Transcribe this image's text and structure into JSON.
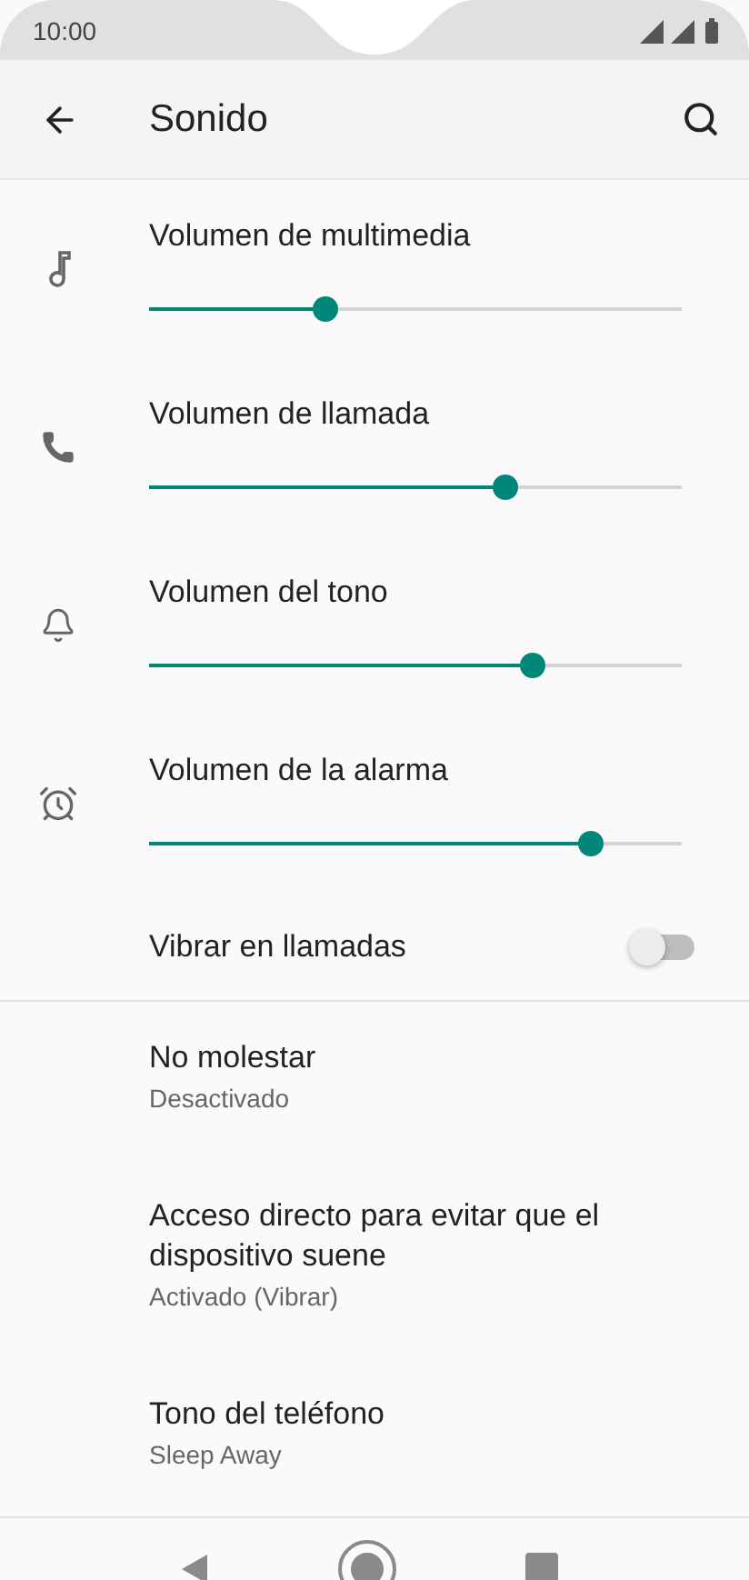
{
  "status_bar": {
    "time": "10:00"
  },
  "app_bar": {
    "title": "Sonido"
  },
  "volume_sliders": [
    {
      "label": "Volumen de multimedia",
      "level": 0.33
    },
    {
      "label": "Volumen de llamada",
      "level": 0.67
    },
    {
      "label": "Volumen del tono",
      "level": 0.72
    },
    {
      "label": "Volumen de la alarma",
      "level": 0.83
    }
  ],
  "vibrate_toggle": {
    "label": "Vibrar en llamadas",
    "on": false
  },
  "settings_items": [
    {
      "title": "No molestar",
      "subtitle": "Desactivado"
    },
    {
      "title": "Acceso directo para evitar que el dispositivo suene",
      "subtitle": "Activado (Vibrar)"
    },
    {
      "title": "Tono del teléfono",
      "subtitle": "Sleep Away"
    }
  ]
}
